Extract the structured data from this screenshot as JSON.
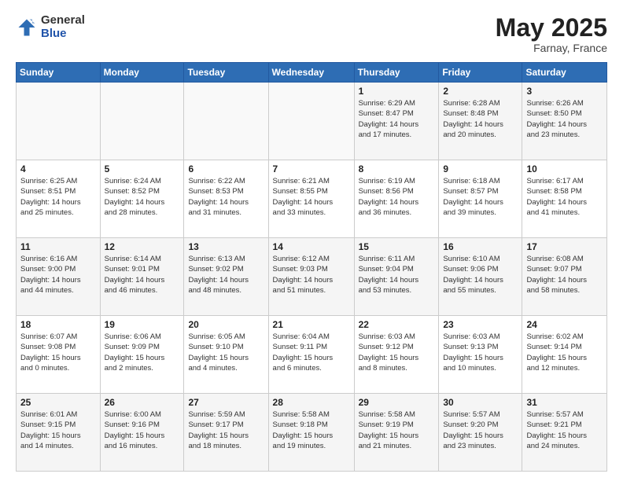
{
  "logo": {
    "general": "General",
    "blue": "Blue"
  },
  "title": "May 2025",
  "subtitle": "Farnay, France",
  "header_days": [
    "Sunday",
    "Monday",
    "Tuesday",
    "Wednesday",
    "Thursday",
    "Friday",
    "Saturday"
  ],
  "weeks": [
    [
      {
        "day": "",
        "info": ""
      },
      {
        "day": "",
        "info": ""
      },
      {
        "day": "",
        "info": ""
      },
      {
        "day": "",
        "info": ""
      },
      {
        "day": "1",
        "info": "Sunrise: 6:29 AM\nSunset: 8:47 PM\nDaylight: 14 hours\nand 17 minutes."
      },
      {
        "day": "2",
        "info": "Sunrise: 6:28 AM\nSunset: 8:48 PM\nDaylight: 14 hours\nand 20 minutes."
      },
      {
        "day": "3",
        "info": "Sunrise: 6:26 AM\nSunset: 8:50 PM\nDaylight: 14 hours\nand 23 minutes."
      }
    ],
    [
      {
        "day": "4",
        "info": "Sunrise: 6:25 AM\nSunset: 8:51 PM\nDaylight: 14 hours\nand 25 minutes."
      },
      {
        "day": "5",
        "info": "Sunrise: 6:24 AM\nSunset: 8:52 PM\nDaylight: 14 hours\nand 28 minutes."
      },
      {
        "day": "6",
        "info": "Sunrise: 6:22 AM\nSunset: 8:53 PM\nDaylight: 14 hours\nand 31 minutes."
      },
      {
        "day": "7",
        "info": "Sunrise: 6:21 AM\nSunset: 8:55 PM\nDaylight: 14 hours\nand 33 minutes."
      },
      {
        "day": "8",
        "info": "Sunrise: 6:19 AM\nSunset: 8:56 PM\nDaylight: 14 hours\nand 36 minutes."
      },
      {
        "day": "9",
        "info": "Sunrise: 6:18 AM\nSunset: 8:57 PM\nDaylight: 14 hours\nand 39 minutes."
      },
      {
        "day": "10",
        "info": "Sunrise: 6:17 AM\nSunset: 8:58 PM\nDaylight: 14 hours\nand 41 minutes."
      }
    ],
    [
      {
        "day": "11",
        "info": "Sunrise: 6:16 AM\nSunset: 9:00 PM\nDaylight: 14 hours\nand 44 minutes."
      },
      {
        "day": "12",
        "info": "Sunrise: 6:14 AM\nSunset: 9:01 PM\nDaylight: 14 hours\nand 46 minutes."
      },
      {
        "day": "13",
        "info": "Sunrise: 6:13 AM\nSunset: 9:02 PM\nDaylight: 14 hours\nand 48 minutes."
      },
      {
        "day": "14",
        "info": "Sunrise: 6:12 AM\nSunset: 9:03 PM\nDaylight: 14 hours\nand 51 minutes."
      },
      {
        "day": "15",
        "info": "Sunrise: 6:11 AM\nSunset: 9:04 PM\nDaylight: 14 hours\nand 53 minutes."
      },
      {
        "day": "16",
        "info": "Sunrise: 6:10 AM\nSunset: 9:06 PM\nDaylight: 14 hours\nand 55 minutes."
      },
      {
        "day": "17",
        "info": "Sunrise: 6:08 AM\nSunset: 9:07 PM\nDaylight: 14 hours\nand 58 minutes."
      }
    ],
    [
      {
        "day": "18",
        "info": "Sunrise: 6:07 AM\nSunset: 9:08 PM\nDaylight: 15 hours\nand 0 minutes."
      },
      {
        "day": "19",
        "info": "Sunrise: 6:06 AM\nSunset: 9:09 PM\nDaylight: 15 hours\nand 2 minutes."
      },
      {
        "day": "20",
        "info": "Sunrise: 6:05 AM\nSunset: 9:10 PM\nDaylight: 15 hours\nand 4 minutes."
      },
      {
        "day": "21",
        "info": "Sunrise: 6:04 AM\nSunset: 9:11 PM\nDaylight: 15 hours\nand 6 minutes."
      },
      {
        "day": "22",
        "info": "Sunrise: 6:03 AM\nSunset: 9:12 PM\nDaylight: 15 hours\nand 8 minutes."
      },
      {
        "day": "23",
        "info": "Sunrise: 6:03 AM\nSunset: 9:13 PM\nDaylight: 15 hours\nand 10 minutes."
      },
      {
        "day": "24",
        "info": "Sunrise: 6:02 AM\nSunset: 9:14 PM\nDaylight: 15 hours\nand 12 minutes."
      }
    ],
    [
      {
        "day": "25",
        "info": "Sunrise: 6:01 AM\nSunset: 9:15 PM\nDaylight: 15 hours\nand 14 minutes."
      },
      {
        "day": "26",
        "info": "Sunrise: 6:00 AM\nSunset: 9:16 PM\nDaylight: 15 hours\nand 16 minutes."
      },
      {
        "day": "27",
        "info": "Sunrise: 5:59 AM\nSunset: 9:17 PM\nDaylight: 15 hours\nand 18 minutes."
      },
      {
        "day": "28",
        "info": "Sunrise: 5:58 AM\nSunset: 9:18 PM\nDaylight: 15 hours\nand 19 minutes."
      },
      {
        "day": "29",
        "info": "Sunrise: 5:58 AM\nSunset: 9:19 PM\nDaylight: 15 hours\nand 21 minutes."
      },
      {
        "day": "30",
        "info": "Sunrise: 5:57 AM\nSunset: 9:20 PM\nDaylight: 15 hours\nand 23 minutes."
      },
      {
        "day": "31",
        "info": "Sunrise: 5:57 AM\nSunset: 9:21 PM\nDaylight: 15 hours\nand 24 minutes."
      }
    ]
  ]
}
